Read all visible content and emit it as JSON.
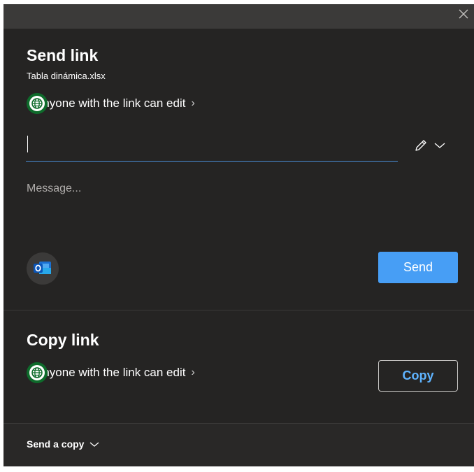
{
  "dialog": {
    "close_icon": "close-icon"
  },
  "send_link": {
    "title": "Send link",
    "filename": "Tabla dinámica.xlsx",
    "link_setting": "Anyone with the link can edit",
    "link_setting_icon": "globe-icon",
    "recipient_value": "",
    "permission_icon": "pencil-icon",
    "message_placeholder": "Message...",
    "outlook_icon": "outlook-icon",
    "send_label": "Send"
  },
  "copy_link": {
    "title": "Copy link",
    "link_setting": "Anyone with the link can edit",
    "copy_label": "Copy"
  },
  "footer": {
    "send_copy_label": "Send a copy"
  },
  "colors": {
    "background": "#252423",
    "accent": "#479ef5",
    "copy_text": "#5fb4ff",
    "globe_ring": "#0e6b2b"
  }
}
